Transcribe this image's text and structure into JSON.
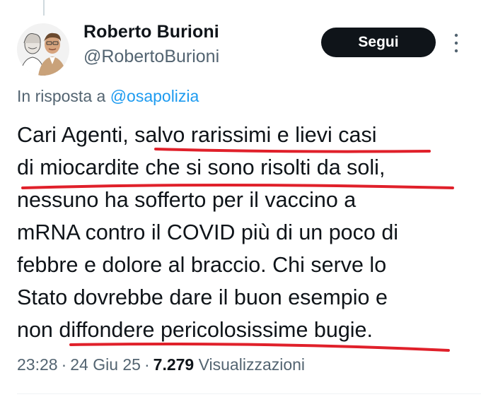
{
  "author": {
    "name": "Roberto Burioni",
    "handle": "@RobertoBurioni",
    "avatar_icon": "profile-photo"
  },
  "follow_button": {
    "label": "Segui"
  },
  "more_icon": "more-vertical-icon",
  "reply_context": {
    "prefix": "In risposta a",
    "mention": "@osapolizia"
  },
  "tweet": {
    "lines": [
      "Cari Agenti, salvo rarissimi e lievi casi",
      "di miocardite che si sono risolti da soli,",
      "nessuno ha sofferto per il vaccino a",
      "mRNA contro il COVID più di un poco di",
      "febbre e dolore al braccio. Chi serve lo",
      "Stato dovrebbe dare il buon esempio e",
      "non diffondere pericolosissime bugie."
    ],
    "annotation_color": "#e0202a"
  },
  "meta": {
    "time": "23:28",
    "date": "24 Giu 25",
    "views": "7.279",
    "views_label": "Visualizzazioni"
  },
  "colors": {
    "text": "#0f1419",
    "secondary": "#536471",
    "link": "#1d9bf0",
    "button_bg": "#0f1419"
  }
}
